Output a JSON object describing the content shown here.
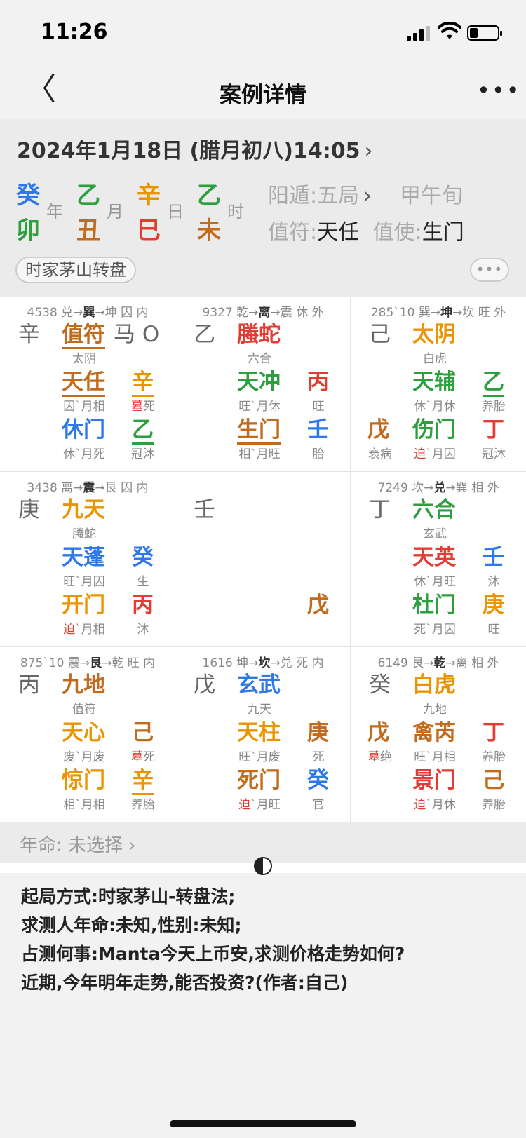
{
  "status": {
    "time": "11:26"
  },
  "nav": {
    "back": "〈",
    "title": "案例详情",
    "more": "•••"
  },
  "header": {
    "datetime": "2024年1月18日 (腊月初八)14:05",
    "chevron": "›",
    "pillars": [
      {
        "stem": "癸",
        "branch": "卯",
        "stem_color": "#2f78e8",
        "branch_color": "#2e9e3e",
        "label": "年"
      },
      {
        "stem": "乙",
        "branch": "丑",
        "stem_color": "#2e9e3e",
        "branch_color": "#c06b1e",
        "label": "月"
      },
      {
        "stem": "辛",
        "branch": "巳",
        "stem_color": "#e99400",
        "branch_color": "#e23d32",
        "label": "日"
      },
      {
        "stem": "乙",
        "branch": "未",
        "stem_color": "#2e9e3e",
        "branch_color": "#c06b1e",
        "label": "时"
      }
    ],
    "dun_label": "阳遁:",
    "dun_value": "五局",
    "xun": "甲午旬",
    "zhifu_label": "值符:",
    "zhifu_value": "天任",
    "zhishi_label": "值使:",
    "zhishi_value": "生门",
    "mode_button": "时家茅山转盘",
    "more_button": "•••"
  },
  "palaces": [
    {
      "hdr_num": "4538",
      "hdr_a": "兑",
      "hdr_b": "巽",
      "hdr_c": "坤",
      "hdr_d": "囚 内",
      "earth_left": "辛",
      "god": "值符",
      "horse": "马 O",
      "god_sub": "太阴",
      "star": "天任",
      "star_stem": "辛",
      "star_sub": "囚`月相",
      "star_stem_hl": "墓",
      "star_stem_sub": "死",
      "door": "休门",
      "door_stem": "乙",
      "door_sub": "休`月死",
      "door_stem_sub": "冠沐"
    },
    {
      "hdr_num": "9327",
      "hdr_a": "乾",
      "hdr_b": "离",
      "hdr_c": "震",
      "hdr_d": "休 外",
      "earth_left": "乙",
      "god": "螣蛇",
      "god_sub": "六合",
      "star": "天冲",
      "star_stem": "丙",
      "star_sub": "旺`月休",
      "star_stem_sub": "旺",
      "door": "生门",
      "door_stem": "壬",
      "door_sub": "相`月旺",
      "door_stem_sub": "胎"
    },
    {
      "hdr_num": "285`10",
      "hdr_a": "巽",
      "hdr_b": "坤",
      "hdr_c": "坎",
      "hdr_d": "旺 外",
      "earth_left": "己",
      "god": "太阴",
      "god_sub": "白虎",
      "star": "天辅",
      "star_stem": "乙",
      "star_sub": "休`月休",
      "star_stem_sub": "养胎",
      "door_left": "戊",
      "door_left_sub": "衰病",
      "door": "伤门",
      "door_stem": "丁",
      "door_sub_hl": "迫",
      "door_sub": "`月囚",
      "door_stem_sub": "冠沐"
    },
    {
      "hdr_num": "3438",
      "hdr_a": "离",
      "hdr_b": "震",
      "hdr_c": "艮",
      "hdr_d": "囚 内",
      "earth_left": "庚",
      "god": "九天",
      "god_sub": "螣蛇",
      "star": "天蓬",
      "star_stem": "癸",
      "star_sub": "旺`月囚",
      "star_stem_sub": "生",
      "door": "开门",
      "door_stem": "丙",
      "door_sub_hl": "迫",
      "door_sub": "`月相",
      "door_stem_sub": "沐"
    },
    {
      "center_left": "壬",
      "center_right": "戊"
    },
    {
      "hdr_num": "7249",
      "hdr_a": "坎",
      "hdr_b": "兑",
      "hdr_c": "巽",
      "hdr_d": "相 外",
      "earth_left": "丁",
      "god": "六合",
      "god_sub": "玄武",
      "star": "天英",
      "star_stem": "壬",
      "star_sub": "休`月旺",
      "star_stem_sub": "沐",
      "door": "杜门",
      "door_stem": "庚",
      "door_sub": "死`月囚",
      "door_stem_sub": "旺"
    },
    {
      "hdr_num": "875`10",
      "hdr_a": "震",
      "hdr_b": "艮",
      "hdr_c": "乾",
      "hdr_d": "旺 内",
      "earth_left": "丙",
      "god": "九地",
      "god_sub": "值符",
      "star": "天心",
      "star_stem": "己",
      "star_sub": "废`月废",
      "star_stem_hl": "墓",
      "star_stem_sub": "死",
      "door": "惊门",
      "door_stem": "辛",
      "door_sub": "相`月相",
      "door_stem_sub": "养胎"
    },
    {
      "hdr_num": "1616",
      "hdr_a": "坤",
      "hdr_b": "坎",
      "hdr_c": "兑",
      "hdr_d": "死 内",
      "earth_left": "戊",
      "god": "玄武",
      "god_sub": "九天",
      "star": "天柱",
      "star_stem": "庚",
      "star_sub": "旺`月废",
      "star_stem_sub": "死",
      "door": "死门",
      "door_stem": "癸",
      "door_sub_hl": "迫",
      "door_sub": "`月旺",
      "door_stem_sub": "官"
    },
    {
      "hdr_num": "6149",
      "hdr_a": "艮",
      "hdr_b": "乾",
      "hdr_c": "离",
      "hdr_d": "相 外",
      "earth_left": "癸",
      "god": "白虎",
      "god_sub": "九地",
      "star_left": "戊",
      "star_left_hl": "墓",
      "star_left_sub": "绝",
      "star": "禽芮",
      "star_stem": "丁",
      "star_sub": "旺`月相",
      "star_stem_sub": "养胎",
      "door": "景门",
      "door_stem": "己",
      "door_sub_hl": "迫",
      "door_sub": "`月休",
      "door_stem_sub": "养胎"
    }
  ],
  "nianming": "年命:  未选择  ›",
  "notes": [
    "起局方式:时家茅山-转盘法;",
    "求测人年命:未知,性别:未知;",
    "占测何事:Manta今天上币安,求测价格走势如何?",
    "近期,今年明年走势,能否投资?(作者:自己)"
  ]
}
